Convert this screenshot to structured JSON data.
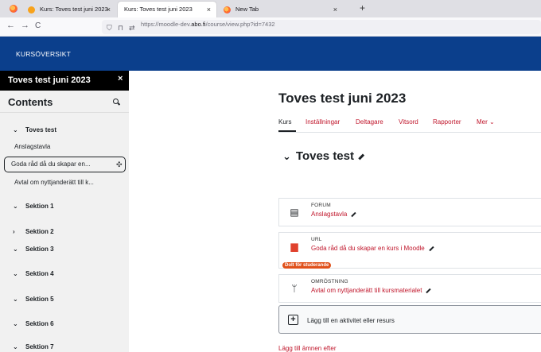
{
  "browser": {
    "tabs": [
      {
        "label": "Kurs: Toves test juni 2023"
      },
      {
        "label": "Kurs: Toves test juni 2023"
      },
      {
        "label": "New Tab"
      }
    ],
    "new_tab_symbol": "+",
    "back_symbol": "←",
    "forward_symbol": "→",
    "reload_symbol": "C",
    "url_prefix": "https://moodle-dev.",
    "url_domain": "abo.fi",
    "url_path": "/course/view.php?id=7432"
  },
  "site": {
    "title": "KURSÖVERSIKT",
    "header_color": "#0b3f8c"
  },
  "drawer": {
    "course_name": "Toves test juni 2023",
    "close_symbol": "×",
    "contents_heading": "Contents",
    "sections": [
      {
        "label": "Toves test",
        "expanded": true,
        "items": [
          "Anslagstavla",
          "Goda råd då du skapar en...",
          "Avtal om nyttjanderätt till k..."
        ]
      },
      {
        "label": "Sektion 1",
        "expanded": true
      },
      {
        "label": "Sektion 2",
        "expanded": false
      },
      {
        "label": "Sektion 3",
        "expanded": true
      },
      {
        "label": "Sektion 4",
        "expanded": true
      },
      {
        "label": "Sektion 5",
        "expanded": true
      },
      {
        "label": "Sektion 6",
        "expanded": true
      },
      {
        "label": "Sektion 7",
        "expanded": true
      }
    ]
  },
  "main": {
    "course_title": "Toves test juni 2023",
    "tabs": [
      {
        "label": "Kurs"
      },
      {
        "label": "Inställningar"
      },
      {
        "label": "Deltagare"
      },
      {
        "label": "Vitsord"
      },
      {
        "label": "Rapporter"
      },
      {
        "label": "Mer ⌄"
      }
    ],
    "section_title": "Toves test",
    "activities": [
      {
        "type": "FORUM",
        "name": "Anslagstavla",
        "icon": "forum-icon"
      },
      {
        "type": "URL",
        "name": "Goda råd då du skapar en kurs i Moodle",
        "icon": "url-icon",
        "badge": "Dolt för studerande"
      },
      {
        "type": "OMRÖSTNING",
        "name": "Avtal om nyttjanderätt till kursmaterialet",
        "icon": "choice-icon"
      }
    ],
    "add_activity_label": "Lägg till en aktivitet eller resurs",
    "add_topic_label": "Lägg till ämnen efter"
  },
  "colors": {
    "link": "#c0162b",
    "badge": "#e0511b"
  }
}
